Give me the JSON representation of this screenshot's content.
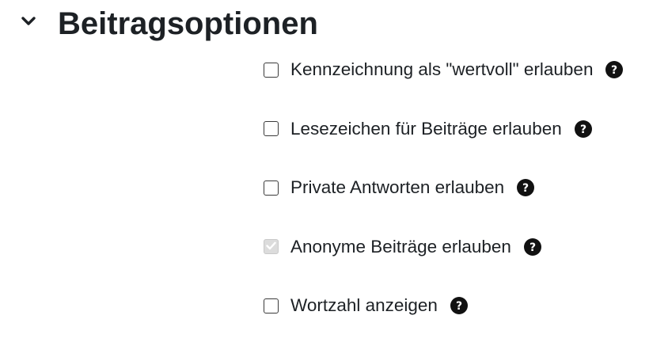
{
  "section": {
    "title": "Beitragsoptionen",
    "toggle_icon": "chevron-down-icon"
  },
  "options": [
    {
      "label": "Kennzeichnung als \"wertvoll\" erlauben",
      "checked": false,
      "disabled": false,
      "help_icon": "question-circle-icon"
    },
    {
      "label": "Lesezeichen für Beiträge erlauben",
      "checked": false,
      "disabled": false,
      "help_icon": "question-circle-icon"
    },
    {
      "label": "Private Antworten erlauben",
      "checked": false,
      "disabled": false,
      "help_icon": "question-circle-icon"
    },
    {
      "label": "Anonyme Beiträge erlauben",
      "checked": true,
      "disabled": true,
      "help_icon": "question-circle-icon"
    },
    {
      "label": "Wortzahl anzeigen",
      "checked": false,
      "disabled": false,
      "help_icon": "question-circle-icon"
    }
  ]
}
